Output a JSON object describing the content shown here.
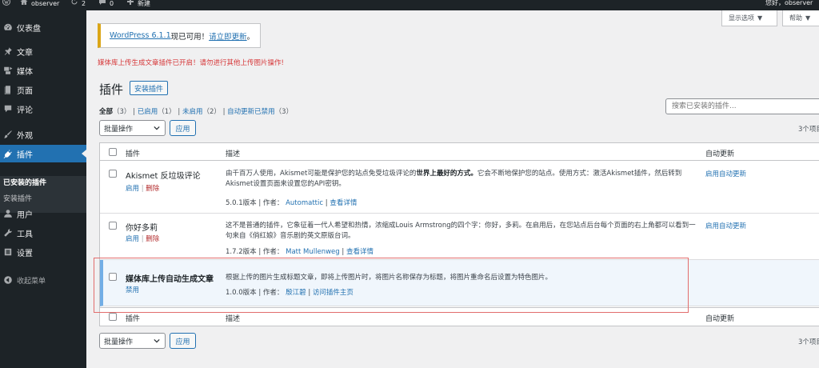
{
  "adminbar": {
    "site_name": "observer",
    "updates_count": "2",
    "comments_count": "0",
    "new_label": "新建",
    "greeting": "您好，observer"
  },
  "sidebar": {
    "items": [
      {
        "label": "仪表盘",
        "icon": "dashboard-icon"
      },
      {
        "label": "文章",
        "icon": "pin-icon"
      },
      {
        "label": "媒体",
        "icon": "media-icon"
      },
      {
        "label": "页面",
        "icon": "page-icon"
      },
      {
        "label": "评论",
        "icon": "comment-icon"
      },
      {
        "label": "外观",
        "icon": "brush-icon"
      },
      {
        "label": "插件",
        "icon": "plugin-icon"
      },
      {
        "label": "用户",
        "icon": "user-icon"
      },
      {
        "label": "工具",
        "icon": "wrench-icon"
      },
      {
        "label": "设置",
        "icon": "settings-icon"
      }
    ],
    "submenu": [
      "已安装的插件",
      "安装插件"
    ],
    "collapse_label": "收起菜单"
  },
  "screen_tabs": {
    "screen_options": "显示选项",
    "help": "帮助"
  },
  "notice": {
    "version_link": "WordPress 6.1.1",
    "middle": "现已可用！",
    "update_link": "请立即更新",
    "end": "。"
  },
  "red_message": "媒体库上传生成文章插件已开启！请勿进行其他上传图片操作!",
  "page": {
    "title": "插件",
    "add_new": "安装插件"
  },
  "filters": {
    "all": "全部",
    "all_count": "（3）",
    "active": "已启用",
    "active_count": "（1）",
    "inactive": "未启用",
    "inactive_count": "（2）",
    "auto_disabled": "自动更新已禁用",
    "auto_disabled_count": "（3）",
    "sep": "|"
  },
  "search": {
    "placeholder": "搜索已安装的插件..."
  },
  "bulk": {
    "label": "批量操作",
    "apply": "应用"
  },
  "count_text": "3个项目",
  "table": {
    "headers": {
      "plugin": "插件",
      "description": "描述",
      "auto_update": "自动更新"
    },
    "rows": [
      {
        "name": "Akismet 反垃圾评论",
        "action1": "启用",
        "action2": "删除",
        "desc_prefix": "由千百万人使用，Akismet可能是保护您的站点免受垃圾评论的",
        "desc_bold": "世界上最好的方式。",
        "desc_suffix": "它会不断地保护您的站点。使用方式：激活Akismet插件，然后转到Akismet设置页面来设置您的API密钥。",
        "version": "5.0.1版本 | 作者：",
        "author": "Automattic",
        "details": "查看详情",
        "auto": "启用自动更新"
      },
      {
        "name": "你好多莉",
        "action1": "启用",
        "action2": "删除",
        "desc": "这不是普通的插件，它象征着一代人希望和热情，浓缩成Louis Armstrong的四个字：你好，多莉。在启用后，在您站点后台每个页面的右上角都可以看到一句来自《俏红娘》音乐剧的英文原版台词。",
        "version": "1.7.2版本 | 作者：",
        "author": "Matt Mullenweg",
        "details": "查看详情",
        "auto": "启用自动更新"
      },
      {
        "name": "媒体库上传自动生成文章",
        "action1": "禁用",
        "desc": "根据上传的图片生成标题文章，即将上传图片时，将图片名称保存为标题，将图片重命名后设置为特色图片。",
        "version": "1.0.0版本 | 作者：",
        "author": "殷江碧",
        "details": "访问插件主页"
      }
    ]
  }
}
